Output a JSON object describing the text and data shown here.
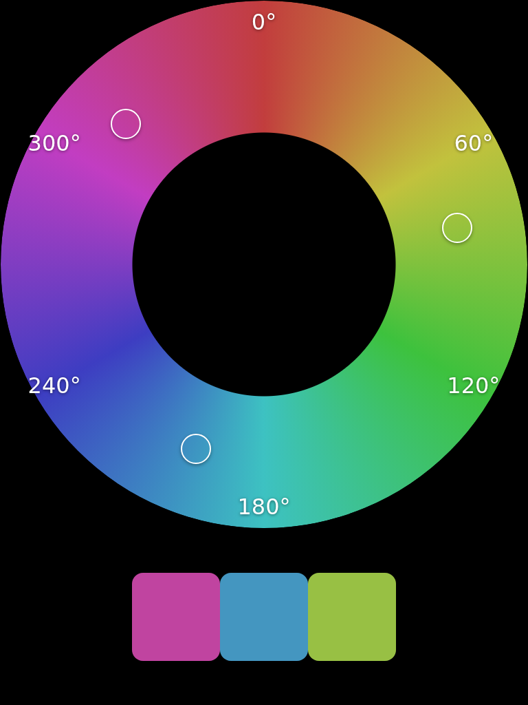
{
  "wheel": {
    "labels": [
      "0°",
      "60°",
      "120°",
      "180°",
      "240°",
      "300°"
    ]
  },
  "selections": [
    {
      "color": "#c044a0"
    },
    {
      "color": "#4496c0"
    },
    {
      "color": "#98c044"
    }
  ]
}
